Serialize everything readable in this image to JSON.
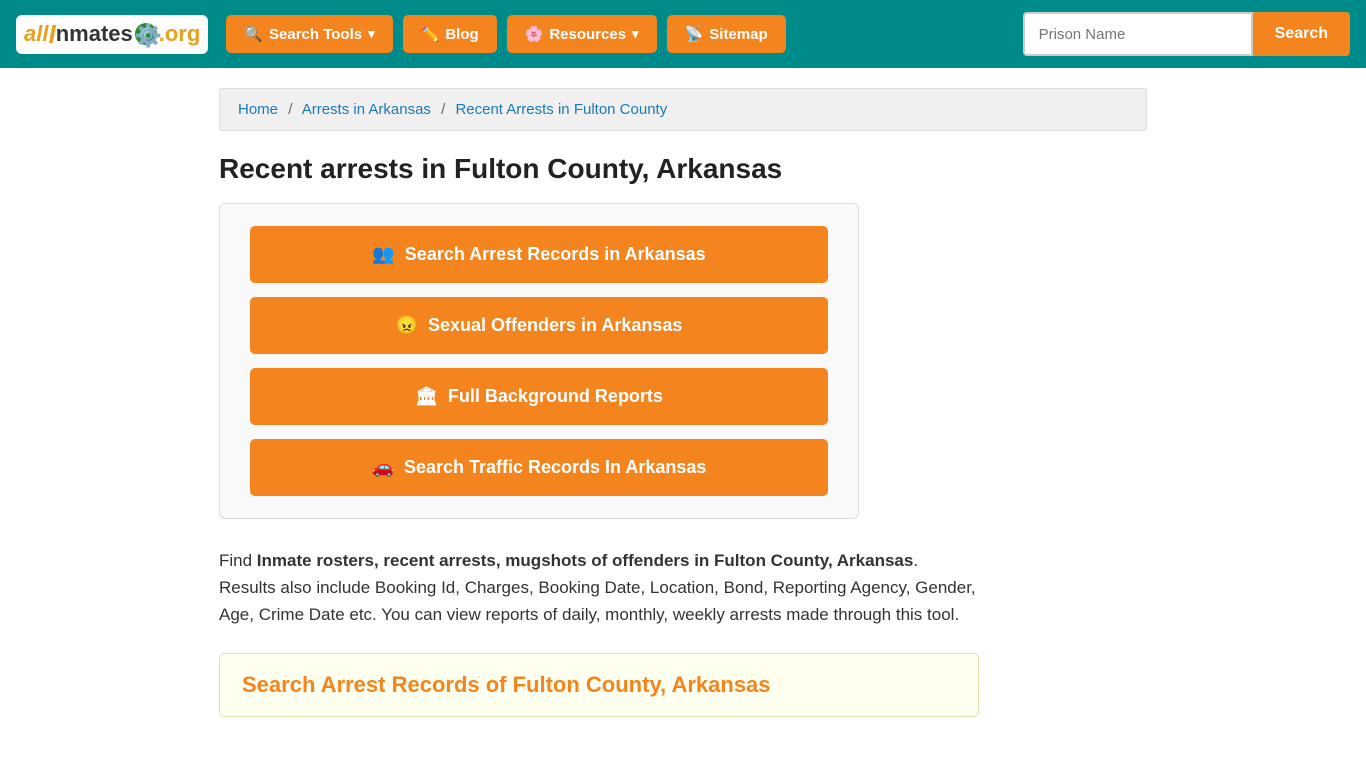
{
  "navbar": {
    "logo": {
      "text": "allInmates.org",
      "all": "all",
      "inmates": "Inmates",
      "org": ".org"
    },
    "nav_items": [
      {
        "id": "search-tools",
        "label": "Search Tools",
        "dropdown": true
      },
      {
        "id": "blog",
        "label": "Blog",
        "dropdown": false
      },
      {
        "id": "resources",
        "label": "Resources",
        "dropdown": true
      },
      {
        "id": "sitemap",
        "label": "Sitemap",
        "dropdown": false
      }
    ],
    "search_placeholder": "Prison Name",
    "search_btn_label": "Search"
  },
  "breadcrumb": {
    "items": [
      {
        "label": "Home",
        "href": "#"
      },
      {
        "label": "Arrests in Arkansas",
        "href": "#"
      },
      {
        "label": "Recent Arrests in Fulton County",
        "href": "#",
        "current": true
      }
    ]
  },
  "page": {
    "title": "Recent arrests in Fulton County, Arkansas",
    "action_buttons": [
      {
        "id": "arrest-records",
        "label": "Search Arrest Records in Arkansas",
        "icon": "people"
      },
      {
        "id": "sexual-offenders",
        "label": "Sexual Offenders in Arkansas",
        "icon": "offender"
      },
      {
        "id": "background-reports",
        "label": "Full Background Reports",
        "icon": "building"
      },
      {
        "id": "traffic-records",
        "label": "Search Traffic Records In Arkansas",
        "icon": "car"
      }
    ],
    "description": {
      "prefix": "Find ",
      "bold_text": "Inmate rosters, recent arrests, mugshots of offenders in Fulton County, Arkansas",
      "suffix": ". Results also include Booking Id, Charges, Booking Date, Location, Bond, Reporting Agency, Gender, Age, Crime Date etc. You can view reports of daily, monthly, weekly arrests made through this tool."
    },
    "search_records_section": {
      "title": "Search Arrest Records of Fulton County, Arkansas"
    }
  }
}
